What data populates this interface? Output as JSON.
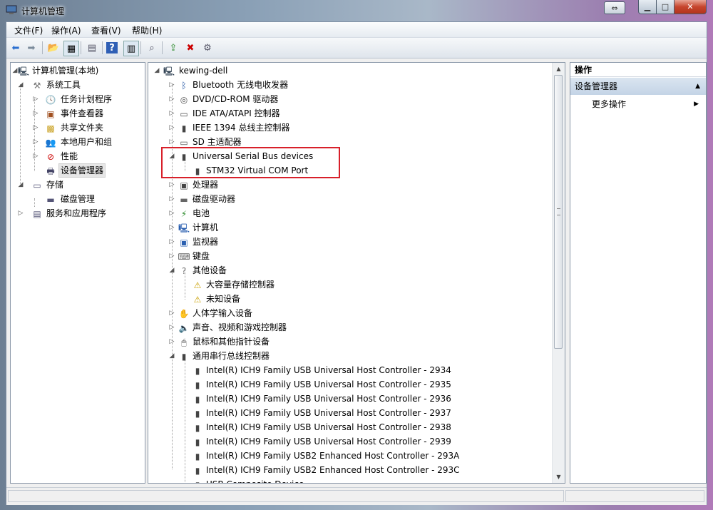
{
  "window": {
    "title": "计算机管理"
  },
  "menu": [
    "文件(F)",
    "操作(A)",
    "查看(V)",
    "帮助(H)"
  ],
  "left_tree": [
    {
      "label": "计算机管理(本地)",
      "icon": "computer-management-icon",
      "level": 0,
      "expander": "open"
    },
    {
      "label": "系统工具",
      "icon": "tools-icon",
      "level": 1,
      "expander": "open"
    },
    {
      "label": "任务计划程序",
      "icon": "clock-icon",
      "level": 2,
      "expander": "closed"
    },
    {
      "label": "事件查看器",
      "icon": "event-viewer-icon",
      "level": 2,
      "expander": "closed"
    },
    {
      "label": "共享文件夹",
      "icon": "shared-folder-icon",
      "level": 2,
      "expander": "closed"
    },
    {
      "label": "本地用户和组",
      "icon": "users-icon",
      "level": 2,
      "expander": "closed"
    },
    {
      "label": "性能",
      "icon": "performance-icon",
      "level": 2,
      "expander": "closed"
    },
    {
      "label": "设备管理器",
      "icon": "device-manager-icon",
      "level": 2,
      "expander": "none",
      "selected": true
    },
    {
      "label": "存储",
      "icon": "storage-icon",
      "level": 1,
      "expander": "open"
    },
    {
      "label": "磁盘管理",
      "icon": "disk-icon",
      "level": 2,
      "expander": "none"
    },
    {
      "label": "服务和应用程序",
      "icon": "services-icon",
      "level": 1,
      "expander": "closed"
    }
  ],
  "device_tree": [
    {
      "label": "kewing-dell",
      "icon": "computer-icon",
      "level": 0,
      "expander": "open"
    },
    {
      "label": "Bluetooth 无线电收发器",
      "icon": "bluetooth-icon",
      "level": 1,
      "expander": "closed"
    },
    {
      "label": "DVD/CD-ROM 驱动器",
      "icon": "dvd-drive-icon",
      "level": 1,
      "expander": "closed"
    },
    {
      "label": "IDE ATA/ATAPI 控制器",
      "icon": "ide-controller-icon",
      "level": 1,
      "expander": "closed"
    },
    {
      "label": "IEEE 1394 总线主控制器",
      "icon": "usb-plug-icon",
      "level": 1,
      "expander": "closed"
    },
    {
      "label": "SD 主适配器",
      "icon": "sd-adapter-icon",
      "level": 1,
      "expander": "closed"
    },
    {
      "label": "Universal Serial Bus devices",
      "icon": "usb-plug-icon",
      "level": 1,
      "expander": "open"
    },
    {
      "label": "STM32 Virtual COM Port",
      "icon": "usb-plug-icon",
      "level": 2,
      "expander": "none"
    },
    {
      "label": "处理器",
      "icon": "processor-icon",
      "level": 1,
      "expander": "closed"
    },
    {
      "label": "磁盘驱动器",
      "icon": "disk-drive-icon",
      "level": 1,
      "expander": "closed"
    },
    {
      "label": "电池",
      "icon": "battery-icon",
      "level": 1,
      "expander": "closed"
    },
    {
      "label": "计算机",
      "icon": "computer-icon",
      "level": 1,
      "expander": "closed"
    },
    {
      "label": "监视器",
      "icon": "monitor-icon",
      "level": 1,
      "expander": "closed"
    },
    {
      "label": "键盘",
      "icon": "keyboard-icon",
      "level": 1,
      "expander": "closed"
    },
    {
      "label": "其他设备",
      "icon": "other-devices-icon",
      "level": 1,
      "expander": "open"
    },
    {
      "label": "大容量存储控制器",
      "icon": "warning-device-icon",
      "level": 2,
      "expander": "none"
    },
    {
      "label": "未知设备",
      "icon": "warning-device-icon",
      "level": 2,
      "expander": "none"
    },
    {
      "label": "人体学输入设备",
      "icon": "hid-icon",
      "level": 1,
      "expander": "closed"
    },
    {
      "label": "声音、视频和游戏控制器",
      "icon": "speaker-icon",
      "level": 1,
      "expander": "closed"
    },
    {
      "label": "鼠标和其他指针设备",
      "icon": "mouse-icon",
      "level": 1,
      "expander": "closed"
    },
    {
      "label": "通用串行总线控制器",
      "icon": "usb-plug-icon",
      "level": 1,
      "expander": "open"
    },
    {
      "label": "Intel(R) ICH9 Family USB Universal Host Controller - 2934",
      "icon": "usb-plug-icon",
      "level": 2,
      "expander": "none"
    },
    {
      "label": "Intel(R) ICH9 Family USB Universal Host Controller - 2935",
      "icon": "usb-plug-icon",
      "level": 2,
      "expander": "none"
    },
    {
      "label": "Intel(R) ICH9 Family USB Universal Host Controller - 2936",
      "icon": "usb-plug-icon",
      "level": 2,
      "expander": "none"
    },
    {
      "label": "Intel(R) ICH9 Family USB Universal Host Controller - 2937",
      "icon": "usb-plug-icon",
      "level": 2,
      "expander": "none"
    },
    {
      "label": "Intel(R) ICH9 Family USB Universal Host Controller - 2938",
      "icon": "usb-plug-icon",
      "level": 2,
      "expander": "none"
    },
    {
      "label": "Intel(R) ICH9 Family USB Universal Host Controller - 2939",
      "icon": "usb-plug-icon",
      "level": 2,
      "expander": "none"
    },
    {
      "label": "Intel(R) ICH9 Family USB2 Enhanced Host Controller - 293A",
      "icon": "usb-plug-icon",
      "level": 2,
      "expander": "none"
    },
    {
      "label": "Intel(R) ICH9 Family USB2 Enhanced Host Controller - 293C",
      "icon": "usb-plug-icon",
      "level": 2,
      "expander": "none"
    },
    {
      "label": "USB Composite Device",
      "icon": "usb-plug-icon",
      "level": 2,
      "expander": "none"
    }
  ],
  "actions_pane": {
    "header": "操作",
    "section": "设备管理器",
    "item": "更多操作"
  },
  "colors": {
    "highlight_box": "#d8202a",
    "warning": "#f0c000"
  }
}
